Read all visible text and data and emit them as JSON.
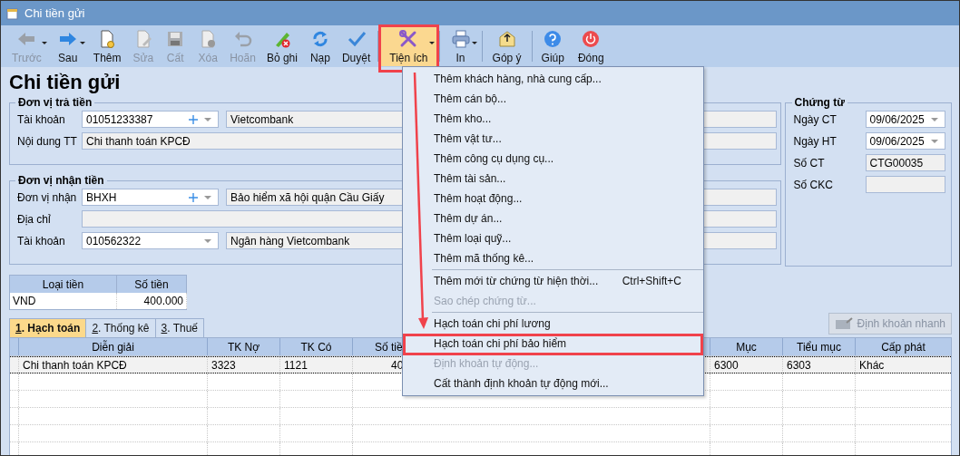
{
  "window": {
    "title": "Chi tiền gửi"
  },
  "toolbar": [
    {
      "kind": "button",
      "label": "Trước",
      "disabled": true,
      "dropdown": true,
      "selected": false,
      "marked": false
    },
    {
      "kind": "button",
      "label": "Sau",
      "disabled": false,
      "dropdown": true,
      "selected": false,
      "marked": false
    },
    {
      "kind": "button",
      "label": "Thêm",
      "disabled": false,
      "dropdown": false,
      "selected": false,
      "marked": false
    },
    {
      "kind": "button",
      "label": "Sửa",
      "disabled": true,
      "dropdown": false,
      "selected": false,
      "marked": false
    },
    {
      "kind": "button",
      "label": "Cất",
      "disabled": true,
      "dropdown": false,
      "selected": false,
      "marked": false
    },
    {
      "kind": "button",
      "label": "Xóa",
      "disabled": true,
      "dropdown": false,
      "selected": false,
      "marked": false
    },
    {
      "kind": "button",
      "label": "Hoãn",
      "disabled": true,
      "dropdown": false,
      "selected": false,
      "marked": false
    },
    {
      "kind": "button",
      "label": "Bỏ ghi",
      "disabled": false,
      "dropdown": false,
      "selected": false,
      "marked": false
    },
    {
      "kind": "button",
      "label": "Nạp",
      "disabled": false,
      "dropdown": false,
      "selected": false,
      "marked": false
    },
    {
      "kind": "button",
      "label": "Duyệt",
      "disabled": false,
      "dropdown": false,
      "selected": false,
      "marked": false
    },
    {
      "kind": "separator"
    },
    {
      "kind": "button",
      "label": "Tiện ích",
      "disabled": false,
      "dropdown": true,
      "selected": true,
      "marked": true
    },
    {
      "kind": "separator"
    },
    {
      "kind": "button",
      "label": "In",
      "disabled": false,
      "dropdown": true,
      "selected": false,
      "marked": false
    },
    {
      "kind": "separator"
    },
    {
      "kind": "button",
      "label": "Góp ý",
      "disabled": false,
      "dropdown": false,
      "selected": false,
      "marked": false
    },
    {
      "kind": "separator"
    },
    {
      "kind": "button",
      "label": "Giúp",
      "disabled": false,
      "dropdown": false,
      "selected": false,
      "marked": false
    },
    {
      "kind": "button",
      "label": "Đóng",
      "disabled": false,
      "dropdown": false,
      "selected": false,
      "marked": false
    }
  ],
  "form_title": "Chi tiền gửi",
  "payer": {
    "title": "Đơn vị trả tiền",
    "rows": [
      {
        "kind": "lookup",
        "label": "Tài khoản",
        "value": "01051233387",
        "name": "Vietcombank"
      },
      {
        "kind": "text",
        "label": "Nội dung TT",
        "value": "Chi thanh toán KPCĐ"
      }
    ]
  },
  "payee": {
    "title": "Đơn vị nhận tiền",
    "rows": [
      {
        "kind": "lookup",
        "label": "Đơn vị nhận",
        "value": "BHXH",
        "name": "Bảo hiểm xã hội quận Cầu Giấy"
      },
      {
        "kind": "text",
        "label": "Địa chỉ"
      },
      {
        "kind": "select",
        "label": "Tài khoản",
        "value": "010562322",
        "name": "Ngân hàng Vietcombank"
      }
    ]
  },
  "voucher": {
    "title": "Chứng từ",
    "rows": [
      {
        "kind": "date",
        "label": "Ngày CT",
        "value": "09/06/2025"
      },
      {
        "kind": "date",
        "label": "Ngày HT",
        "value": "09/06/2025"
      },
      {
        "kind": "text",
        "label": "Số CT",
        "value": "CTG00035"
      },
      {
        "kind": "text",
        "label": "Số CKC"
      }
    ]
  },
  "currency_table": {
    "columns": [
      "Loại tiền",
      "Số tiền"
    ],
    "rows": [
      [
        "VND",
        "400.000"
      ]
    ]
  },
  "tabs": [
    {
      "label": "1. Hạch toán",
      "selected": true
    },
    {
      "label": "2. Thống kê",
      "selected": false
    },
    {
      "label": "3. Thuế",
      "selected": false
    }
  ],
  "quick_button": {
    "label": "Định khoản nhanh",
    "disabled": true
  },
  "grid": {
    "columns": [
      "Diễn giải",
      "TK Nợ",
      "TK Có",
      "Số tiề",
      "Mục",
      "Tiểu mục",
      "Cấp phát"
    ],
    "rows": [
      {
        "selected": true,
        "cells": [
          "Chi thanh toán KPCĐ",
          "3323",
          "1121",
          "40",
          "6300",
          "6303",
          "Khác"
        ]
      }
    ]
  },
  "menu": {
    "items": [
      {
        "kind": "item",
        "label": "Thêm khách hàng, nhà cung cấp...",
        "disabled": false,
        "marked": false
      },
      {
        "kind": "item",
        "label": "Thêm cán bộ...",
        "disabled": false,
        "marked": false
      },
      {
        "kind": "item",
        "label": "Thêm kho...",
        "disabled": false,
        "marked": false
      },
      {
        "kind": "item",
        "label": "Thêm vật tư...",
        "disabled": false,
        "marked": false
      },
      {
        "kind": "item",
        "label": "Thêm công cụ dụng cụ...",
        "disabled": false,
        "marked": false
      },
      {
        "kind": "item",
        "label": "Thêm tài sản...",
        "disabled": false,
        "marked": false
      },
      {
        "kind": "item",
        "label": "Thêm hoạt động...",
        "disabled": false,
        "marked": false
      },
      {
        "kind": "item",
        "label": "Thêm dự án...",
        "disabled": false,
        "marked": false
      },
      {
        "kind": "item",
        "label": "Thêm loại quỹ...",
        "disabled": false,
        "marked": false
      },
      {
        "kind": "item",
        "label": "Thêm mã thống kê...",
        "disabled": false,
        "marked": false
      },
      {
        "kind": "separator"
      },
      {
        "kind": "item",
        "label": "Thêm mới từ chứng từ hiện thời...",
        "shortcut": "Ctrl+Shift+C",
        "disabled": false,
        "marked": false
      },
      {
        "kind": "item",
        "label": "Sao chép chứng từ...",
        "disabled": true,
        "marked": false
      },
      {
        "kind": "separator"
      },
      {
        "kind": "item",
        "label": "Hạch toán chi phí lương",
        "disabled": false,
        "marked": false
      },
      {
        "kind": "item",
        "label": "Hạch toán chi phí bảo hiểm",
        "disabled": false,
        "marked": true
      },
      {
        "kind": "item",
        "label": "Định khoản tự động...",
        "disabled": true,
        "marked": false
      },
      {
        "kind": "item",
        "label": "Cất thành định khoản tự động mới...",
        "disabled": false,
        "marked": false
      }
    ]
  }
}
